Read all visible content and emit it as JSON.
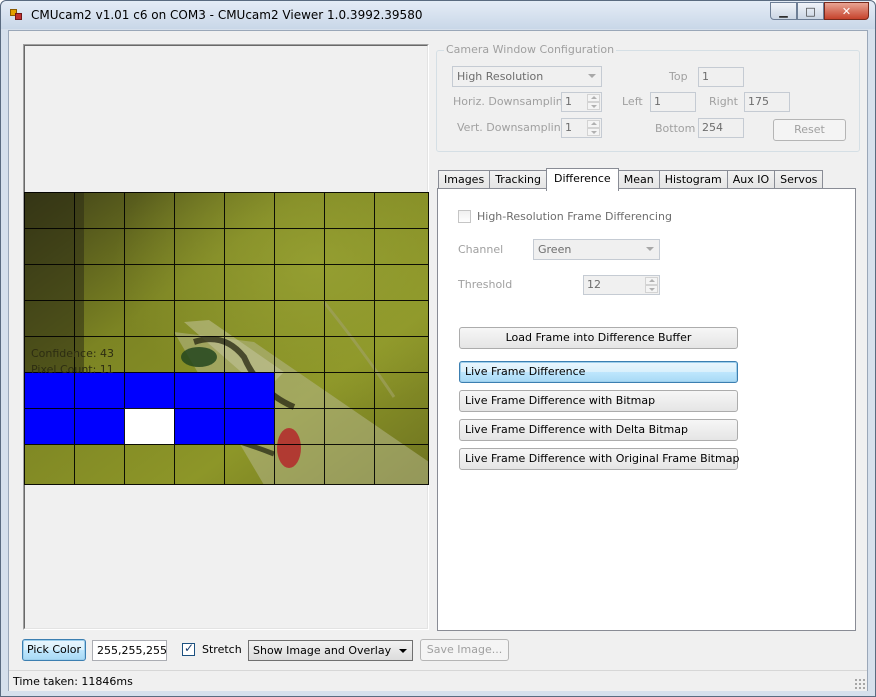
{
  "window": {
    "title": "CMUcam2 v1.01 c6 on COM3 - CMUcam2 Viewer 1.0.3992.39580",
    "minimize": "▁",
    "maximize": "□",
    "close": "✕"
  },
  "camera": {
    "confidence": "Confidence: 43",
    "pixel_count": "Pixel Count: 11"
  },
  "config": {
    "legend": "Camera Window Configuration",
    "resolution": "High Resolution",
    "top_label": "Top",
    "top_value": "1",
    "horiz_label": "Horiz. Downsampling",
    "horiz_value": "1",
    "left_label": "Left",
    "left_value": "1",
    "right_label": "Right",
    "right_value": "175",
    "vert_label": "Vert. Downsampling",
    "vert_value": "1",
    "bottom_label": "Bottom",
    "bottom_value": "254",
    "reset_label": "Reset"
  },
  "tabs": {
    "images": "Images",
    "tracking": "Tracking",
    "difference": "Difference",
    "mean": "Mean",
    "histogram": "Histogram",
    "auxio": "Aux IO",
    "servos": "Servos"
  },
  "difference": {
    "hires_label": "High-Resolution Frame Differencing",
    "hires_checked": false,
    "channel_label": "Channel",
    "channel_value": "Green",
    "threshold_label": "Threshold",
    "threshold_value": "12",
    "load_button": "Load Frame into Difference Buffer",
    "live_button": "Live Frame Difference",
    "live_bitmap_button": "Live Frame Difference with Bitmap",
    "live_delta_button": "Live Frame Difference with Delta Bitmap",
    "live_original_button": "Live Frame Difference with Original Frame Bitmap"
  },
  "bottom": {
    "pick_color": "Pick Color",
    "color_value": "255,255,255",
    "stretch_label": "Stretch",
    "stretch_checked": true,
    "display_mode": "Show Image and Overlay",
    "save_image": "Save Image..."
  },
  "status": {
    "text": "Time taken: 11846ms"
  },
  "colors": {
    "overlay_blue": "#0000ff",
    "overlay_white": "#ffffff",
    "camera_tint": "#7d8420"
  }
}
